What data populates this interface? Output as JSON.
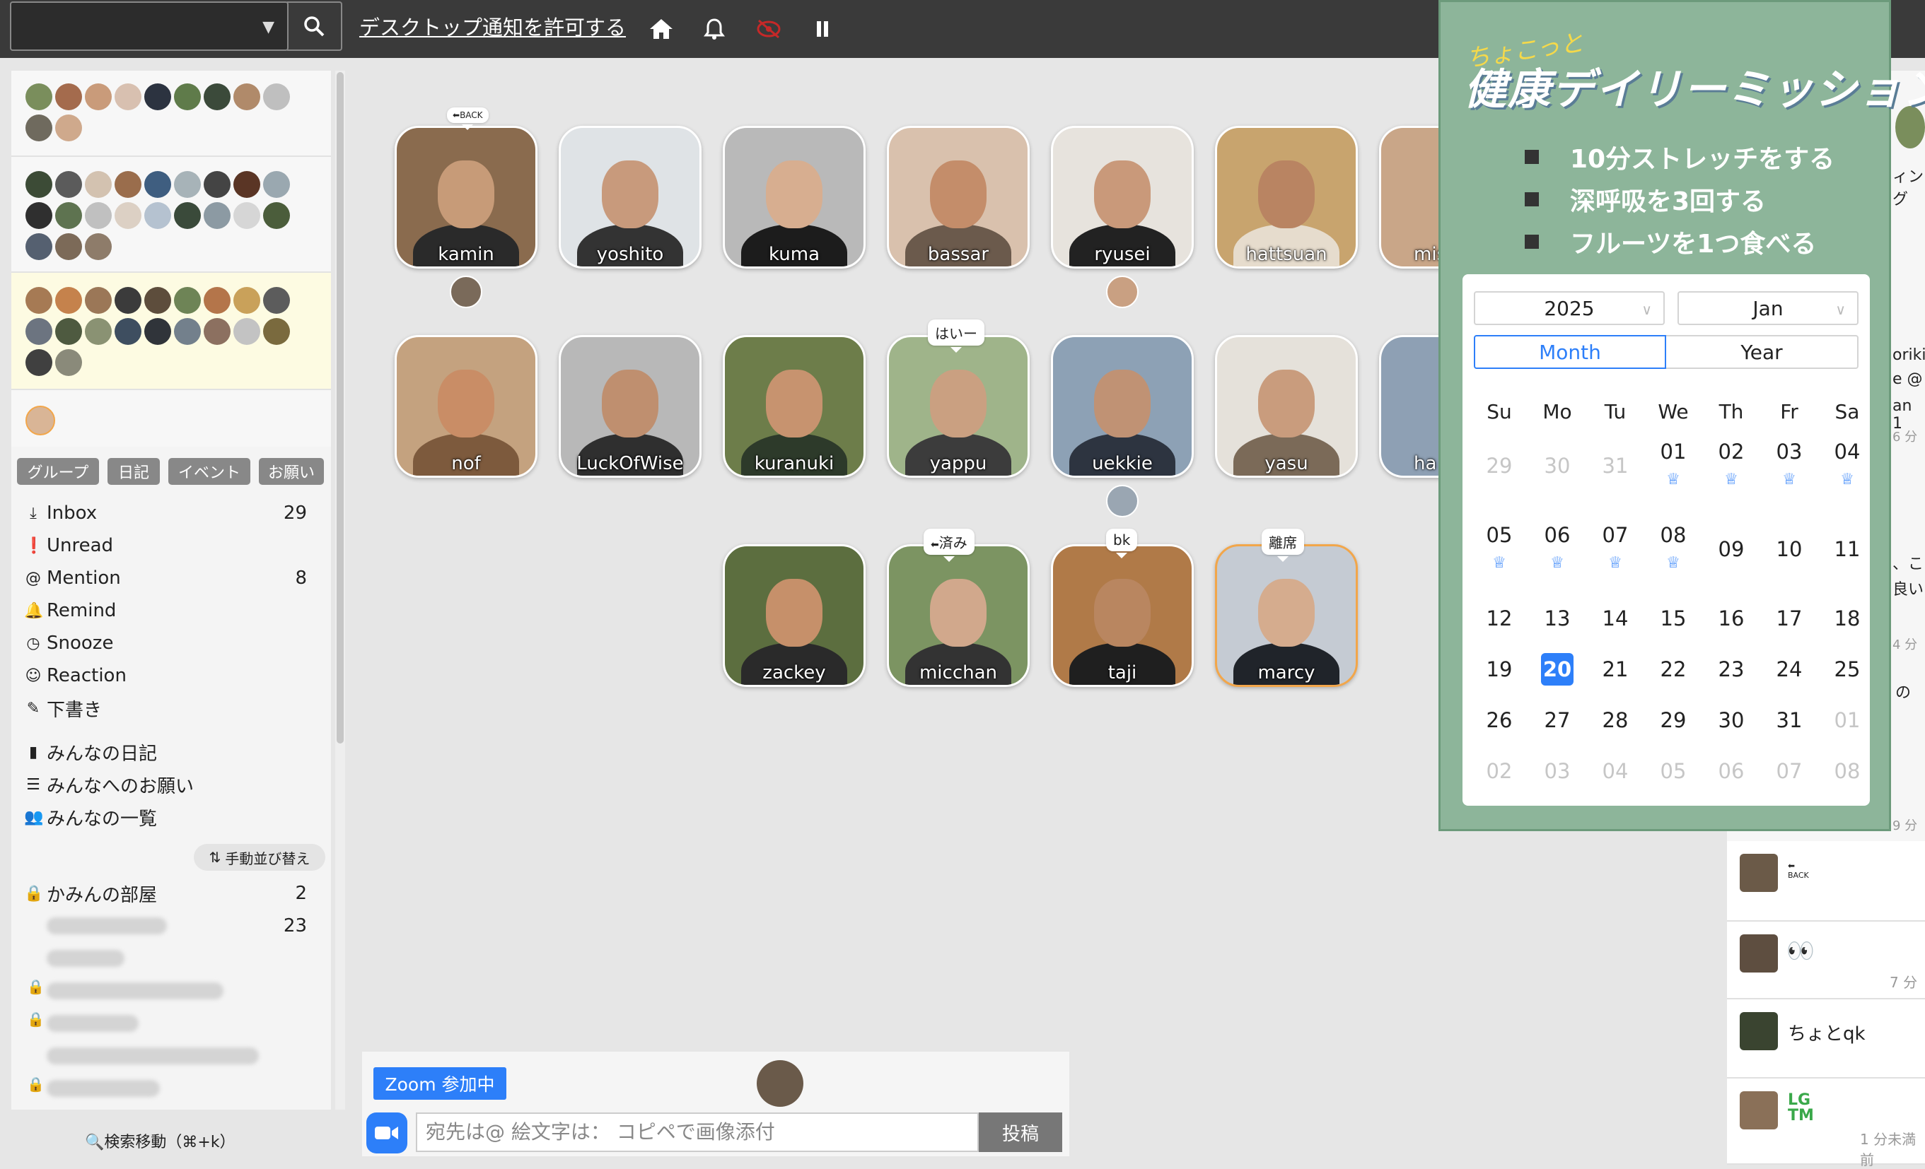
{
  "topbar": {
    "room_select_value": "",
    "notify_link": "デスクトップ通知を許可する",
    "icons": [
      "search-icon",
      "home-icon",
      "bell-icon",
      "eye-slash-icon",
      "pause-icon"
    ]
  },
  "sidebar": {
    "chips": [
      "グループ",
      "日記",
      "イベント",
      "お願い"
    ],
    "menu": [
      {
        "label": "Inbox",
        "count": "29",
        "icon": "inbox-icon"
      },
      {
        "label": "Unread",
        "count": "",
        "icon": "exclamation-icon"
      },
      {
        "label": "Mention",
        "count": "8",
        "icon": "at-icon"
      },
      {
        "label": "Remind",
        "count": "",
        "icon": "bell-icon"
      },
      {
        "label": "Snooze",
        "count": "",
        "icon": "clock-icon"
      },
      {
        "label": "Reaction",
        "count": "",
        "icon": "smile-icon"
      },
      {
        "label": "下書き",
        "count": "",
        "icon": "edit-icon"
      }
    ],
    "menu2": [
      {
        "label": "みんなの日記",
        "icon": "book-icon"
      },
      {
        "label": "みんなへのお願い",
        "icon": "list-icon"
      },
      {
        "label": "みんなの一覧",
        "icon": "users-icon"
      }
    ],
    "sort_button": "手動並び替え",
    "room": {
      "label": "かみんの部屋",
      "count": "2"
    },
    "sub_count": "23",
    "search_move": "検索移動（⌘+k）"
  },
  "users": {
    "row1": [
      "kamin",
      "yoshito",
      "kuma",
      "bassar",
      "ryusei",
      "hattsuan",
      "mis"
    ],
    "row2": [
      "nof",
      "LuckOfWise",
      "kuranuki",
      "yappu",
      "uekkie",
      "yasu",
      "ha"
    ],
    "row3": [
      "zackey",
      "micchan",
      "taji",
      "marcy"
    ]
  },
  "bubbles": {
    "kamin": "BACK",
    "yappu": "はいー",
    "micchan": "済み",
    "taji": "bk",
    "marcy": "離席"
  },
  "composer": {
    "zoom_badge": "Zoom 参加中",
    "placeholder": "宛先は@ 絵文字は： コピペで画像添付",
    "post": "投稿"
  },
  "right_feed": {
    "items": [
      {
        "text": "BACK",
        "time": ""
      },
      {
        "text": "👀",
        "time": "7 分"
      },
      {
        "text": "ちょとqk",
        "time": ""
      },
      {
        "text": "LGTM",
        "time": "1 分未満前"
      }
    ],
    "partial_texts": [
      "oriki",
      "e @",
      "an 1",
      "6 分",
      "ィング",
      "、こ",
      "良い",
      "4 分",
      "の",
      "9 分"
    ]
  },
  "mission": {
    "small_title": "ちょこっと",
    "title": "健康デイリーミッション",
    "tasks": [
      "10分ストレッチをする",
      "深呼吸を3回する",
      "フルーツを1つ食べる"
    ]
  },
  "calendar": {
    "year": "2025",
    "month": "Jan",
    "modes": [
      "Month",
      "Year"
    ],
    "active_mode": "Month",
    "weekdays": [
      "Su",
      "Mo",
      "Tu",
      "We",
      "Th",
      "Fr",
      "Sa"
    ],
    "weeks": [
      [
        "29",
        "30",
        "31",
        "01",
        "02",
        "03",
        "04"
      ],
      [
        "05",
        "06",
        "07",
        "08",
        "09",
        "10",
        "11"
      ],
      [
        "12",
        "13",
        "14",
        "15",
        "16",
        "17",
        "18"
      ],
      [
        "19",
        "20",
        "21",
        "22",
        "23",
        "24",
        "25"
      ],
      [
        "26",
        "27",
        "28",
        "29",
        "30",
        "31",
        "01"
      ],
      [
        "02",
        "03",
        "04",
        "05",
        "06",
        "07",
        "08"
      ]
    ],
    "today": "20",
    "accent": "#2d7ff9"
  }
}
